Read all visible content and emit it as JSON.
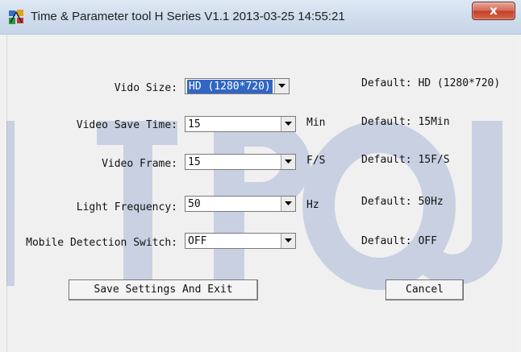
{
  "window": {
    "title": "Time & Parameter tool H Series V1.1 2013-03-25 14:55:21",
    "close_label": "x",
    "icon": "app-icon"
  },
  "colors": {
    "watermark": "#3f62b3",
    "selection": "#3166c4",
    "close_button": "#c9452c"
  },
  "settings": [
    {
      "label": "Vido Size:",
      "value": "HD (1280*720)",
      "unit": "",
      "default": "Default: HD (1280*720)"
    },
    {
      "label": "Video Save Time:",
      "value": "15",
      "unit": "Min",
      "default": "Default: 15Min"
    },
    {
      "label": "Video Frame:",
      "value": "15",
      "unit": "F/S",
      "default": "Default: 15F/S"
    },
    {
      "label": "Light Frequency:",
      "value": "50",
      "unit": "Hz",
      "default": "Default: 50Hz"
    },
    {
      "label": "Mobile Detection Switch:",
      "value": "OFF",
      "unit": "",
      "default": "Default: OFF"
    }
  ],
  "buttons": {
    "save": "Save Settings And Exit",
    "cancel": "Cancel"
  }
}
